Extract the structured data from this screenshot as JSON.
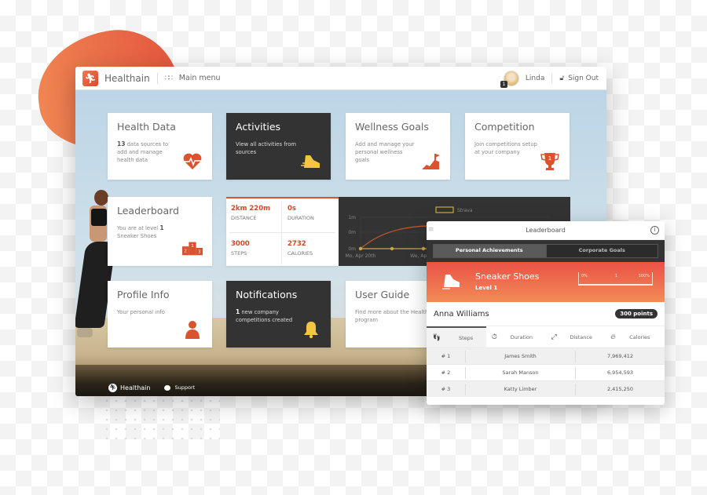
{
  "header": {
    "brand": "Healthain",
    "menu_label": "Main menu",
    "user_name": "Linda",
    "notification_count": "1",
    "sign_out": "Sign Out"
  },
  "tiles": [
    {
      "title": "Health Data",
      "count": "13",
      "desc": " data sources to add and manage health data",
      "icon": "heart-pulse-icon"
    },
    {
      "title": "Activities",
      "desc": "View all activities from sources",
      "icon": "running-shoe-icon"
    },
    {
      "title": "Wellness Goals",
      "desc": "Add and manage your personal wellness goals",
      "icon": "mountain-flag-icon"
    },
    {
      "title": "Competition",
      "desc": "Join competitions setup at your company",
      "icon": "trophy-icon"
    },
    {
      "title": "Leaderboard",
      "desc_prefix": "You are at level ",
      "level": "1",
      "desc_suffix": "Sneaker Shoes",
      "icon": "podium-icon"
    },
    {
      "title": "Profile Info",
      "desc": "Your personal info",
      "icon": "person-icon"
    },
    {
      "title": "Notifications",
      "count": "1",
      "desc": " new company competitions created",
      "icon": "bell-icon"
    },
    {
      "title": "User Guide",
      "desc": "Find more about the Health program",
      "icon": ""
    }
  ],
  "stats": [
    {
      "value": "2km 220m",
      "label": "DISTANCE"
    },
    {
      "value": "0s",
      "label": "DURATION"
    },
    {
      "value": "3000",
      "label": "STEPS"
    },
    {
      "value": "2732",
      "label": "CALORIES"
    }
  ],
  "mini_chart": {
    "legend": "Strava",
    "y_ticks": [
      "1m",
      "0m",
      "0m"
    ],
    "x_ticks": [
      "Mo, Apr 20th",
      "We, Apr"
    ],
    "colors": {
      "line": "#c9592d",
      "strava": "#c8a94a"
    }
  },
  "footer": {
    "brand": "Healthain",
    "support": "Support"
  },
  "leaderboard": {
    "title": "Leaderboard",
    "tabs": [
      {
        "label": "Personal Achievements",
        "active": true
      },
      {
        "label": "Corporate Goals",
        "active": false
      }
    ],
    "achievement": {
      "name": "Sneaker Shoes",
      "level": "Level 1",
      "progress_min": "0%",
      "progress_mid": "1",
      "progress_max": "100%"
    },
    "user": {
      "name": "Anna Williams",
      "points": "300 points"
    },
    "metrics": [
      {
        "label": "Steps",
        "icon": "footsteps-icon",
        "active": true
      },
      {
        "label": "Duration",
        "icon": "stopwatch-icon",
        "active": false
      },
      {
        "label": "Distance",
        "icon": "expand-arrows-icon",
        "active": false
      },
      {
        "label": "Calories",
        "icon": "flame-icon",
        "active": false
      }
    ],
    "rows": [
      {
        "rank": "# 1",
        "name": "James Smith",
        "score": "7,969,412"
      },
      {
        "rank": "# 2",
        "name": "Sarah Manson",
        "score": "6,954,593"
      },
      {
        "rank": "# 3",
        "name": "Katty Limber",
        "score": "2,415,250"
      }
    ]
  },
  "colors": {
    "accent": "#d9532f",
    "dark_tile": "#333333",
    "banner_start": "#ea5246",
    "banner_end": "#f28b57"
  }
}
